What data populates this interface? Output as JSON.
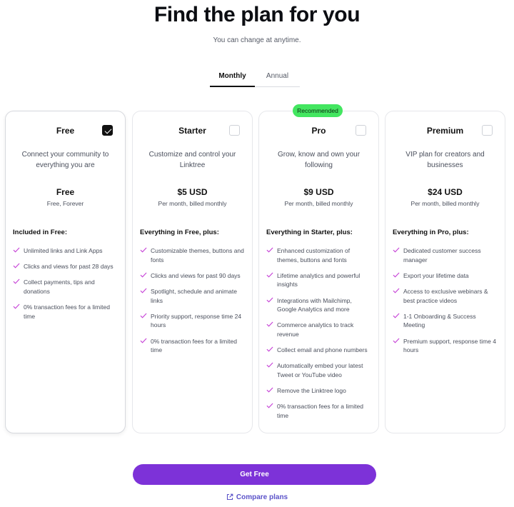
{
  "header": {
    "title": "Find the plan for you",
    "subtitle": "You can change at anytime."
  },
  "billing_tabs": [
    {
      "label": "Monthly",
      "active": true
    },
    {
      "label": "Annual",
      "active": false
    }
  ],
  "recommended_badge": "Recommended",
  "colors": {
    "accent": "#7d32d8",
    "check": "#c53fd6",
    "badge": "#43e660",
    "link": "#5b53c9"
  },
  "plans": [
    {
      "name": "Free",
      "selected": true,
      "description": "Connect your community to everything you are",
      "price": "Free",
      "price_note": "Free, Forever",
      "features_title": "Included in Free:",
      "features": [
        "Unlimited links and Link Apps",
        "Clicks and views for past 28 days",
        "Collect payments, tips and donations",
        "0% transaction fees for a limited time"
      ]
    },
    {
      "name": "Starter",
      "selected": false,
      "description": "Customize and control your Linktree",
      "price": "$5 USD",
      "price_note": "Per month, billed monthly",
      "features_title": "Everything in Free, plus:",
      "features": [
        "Customizable themes, buttons and fonts",
        "Clicks and views for past 90 days",
        "Spotlight, schedule and animate links",
        "Priority support, response time 24 hours",
        "0% transaction fees for a limited time"
      ]
    },
    {
      "name": "Pro",
      "selected": false,
      "description": "Grow, know and own your following",
      "price": "$9 USD",
      "price_note": "Per month, billed monthly",
      "features_title": "Everything in Starter, plus:",
      "features": [
        "Enhanced customization of themes, buttons and fonts",
        "Lifetime analytics and powerful insights",
        "Integrations with Mailchimp, Google Analytics and more",
        "Commerce analytics to track revenue",
        "Collect email and phone numbers",
        "Automatically embed your latest Tweet or YouTube video",
        "Remove the Linktree logo",
        "0% transaction fees for a limited time"
      ]
    },
    {
      "name": "Premium",
      "selected": false,
      "description": "VIP plan for creators and businesses",
      "price": "$24 USD",
      "price_note": "Per month, billed monthly",
      "features_title": "Everything in Pro, plus:",
      "features": [
        "Dedicated customer success manager",
        "Export your lifetime data",
        "Access to exclusive webinars & best practice videos",
        "1-1 Onboarding & Success Meeting",
        "Premium support, response time 4 hours"
      ]
    }
  ],
  "cta": {
    "label": "Get Free"
  },
  "compare_link": {
    "label": "Compare plans",
    "icon": "external-link-icon"
  }
}
